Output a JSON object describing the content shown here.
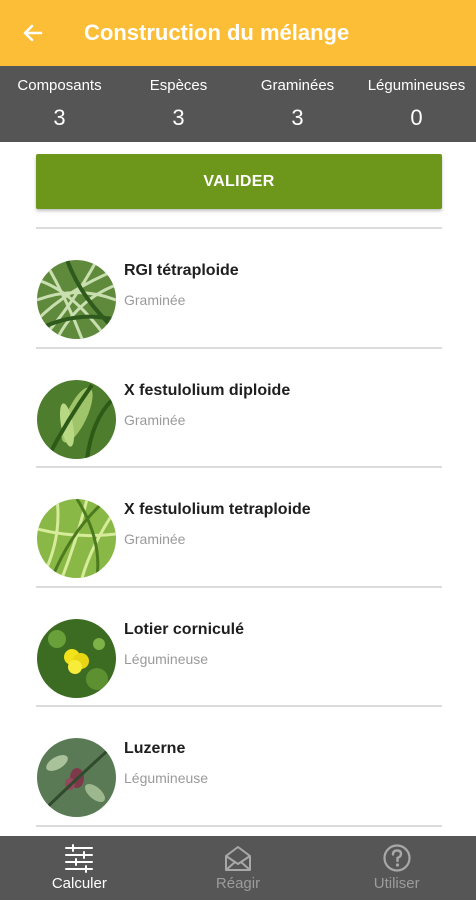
{
  "app_bar": {
    "title": "Construction du mélange",
    "back_icon": "arrow-left-icon",
    "color": "#fdbe37"
  },
  "stats": [
    {
      "label": "Composants",
      "value": "3"
    },
    {
      "label": "Espèces",
      "value": "3"
    },
    {
      "label": "Graminées",
      "value": "3"
    },
    {
      "label": "Légumineuses",
      "value": "0"
    }
  ],
  "validate_button": {
    "label": "VALIDER",
    "color": "#6c971b"
  },
  "species": [
    {
      "name": "RGI tétraploide",
      "type": "Graminée",
      "icon": "grass-photo"
    },
    {
      "name": "X festulolium diploide",
      "type": "Graminée",
      "icon": "grass-photo"
    },
    {
      "name": "X festulolium tetraploide",
      "type": "Graminée",
      "icon": "grass-photo"
    },
    {
      "name": "Lotier corniculé",
      "type": "Légumineuse",
      "icon": "yellow-flower-photo"
    },
    {
      "name": "Luzerne",
      "type": "Légumineuse",
      "icon": "alfalfa-photo"
    }
  ],
  "bottom_nav": [
    {
      "label": "Calculer",
      "icon": "sliders-icon",
      "active": true
    },
    {
      "label": "Réagir",
      "icon": "envelope-icon",
      "active": false
    },
    {
      "label": "Utiliser",
      "icon": "help-circle-icon",
      "active": false
    }
  ]
}
